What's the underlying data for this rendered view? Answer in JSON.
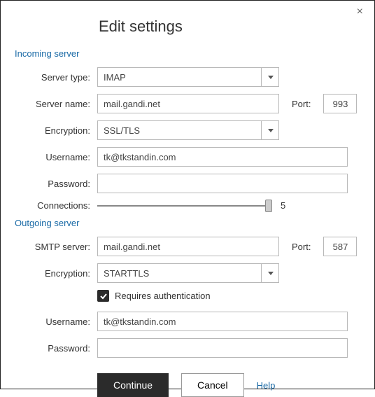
{
  "title": "Edit settings",
  "close_icon": "×",
  "incoming": {
    "section": "Incoming server",
    "server_type_label": "Server type:",
    "server_type_value": "IMAP",
    "server_name_label": "Server name:",
    "server_name_value": "mail.gandi.net",
    "port_label": "Port:",
    "port_value": "993",
    "encryption_label": "Encryption:",
    "encryption_value": "SSL/TLS",
    "username_label": "Username:",
    "username_value": "tk@tkstandin.com",
    "password_label": "Password:",
    "password_value": "",
    "connections_label": "Connections:",
    "connections_value": "5",
    "connections_min": "1",
    "connections_max": "5"
  },
  "outgoing": {
    "section": "Outgoing server",
    "smtp_label": "SMTP server:",
    "smtp_value": "mail.gandi.net",
    "port_label": "Port:",
    "port_value": "587",
    "encryption_label": "Encryption:",
    "encryption_value": "STARTTLS",
    "requires_auth_label": "Requires authentication",
    "requires_auth_checked": true,
    "username_label": "Username:",
    "username_value": "tk@tkstandin.com",
    "password_label": "Password:",
    "password_value": ""
  },
  "buttons": {
    "continue": "Continue",
    "cancel": "Cancel",
    "help": "Help"
  }
}
